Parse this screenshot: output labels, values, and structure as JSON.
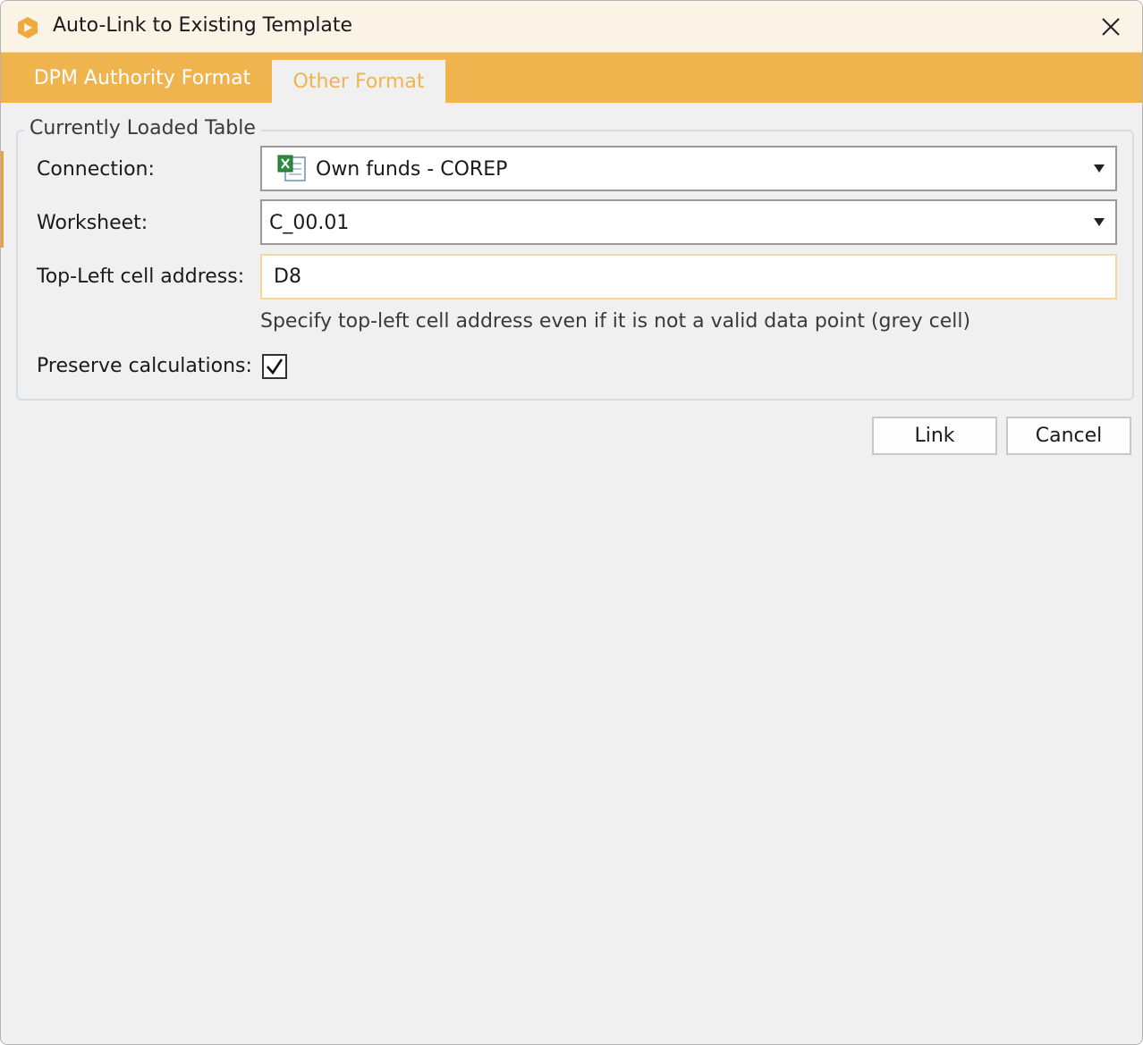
{
  "window": {
    "title": "Auto-Link to Existing Template",
    "close_symbol": "✕"
  },
  "tabs": [
    {
      "label": "DPM Authority Format",
      "active": false
    },
    {
      "label": "Other Format",
      "active": true
    }
  ],
  "group": {
    "title": "Currently Loaded Table",
    "connection": {
      "label": "Connection:",
      "value": "Own funds - COREP",
      "icon": "excel-icon"
    },
    "worksheet": {
      "label": "Worksheet:",
      "value": "C_00.01"
    },
    "top_left": {
      "label": "Top-Left cell address:",
      "value": "D8",
      "hint": "Specify top-left cell address even if it is not a valid data point (grey cell)"
    },
    "preserve": {
      "label": "Preserve calculations:",
      "checked": true
    }
  },
  "buttons": {
    "link": "Link",
    "cancel": "Cancel"
  },
  "colors": {
    "accent": "#f0b44f",
    "titlebar": "#fbf3e6",
    "background": "#f0f0f0"
  }
}
